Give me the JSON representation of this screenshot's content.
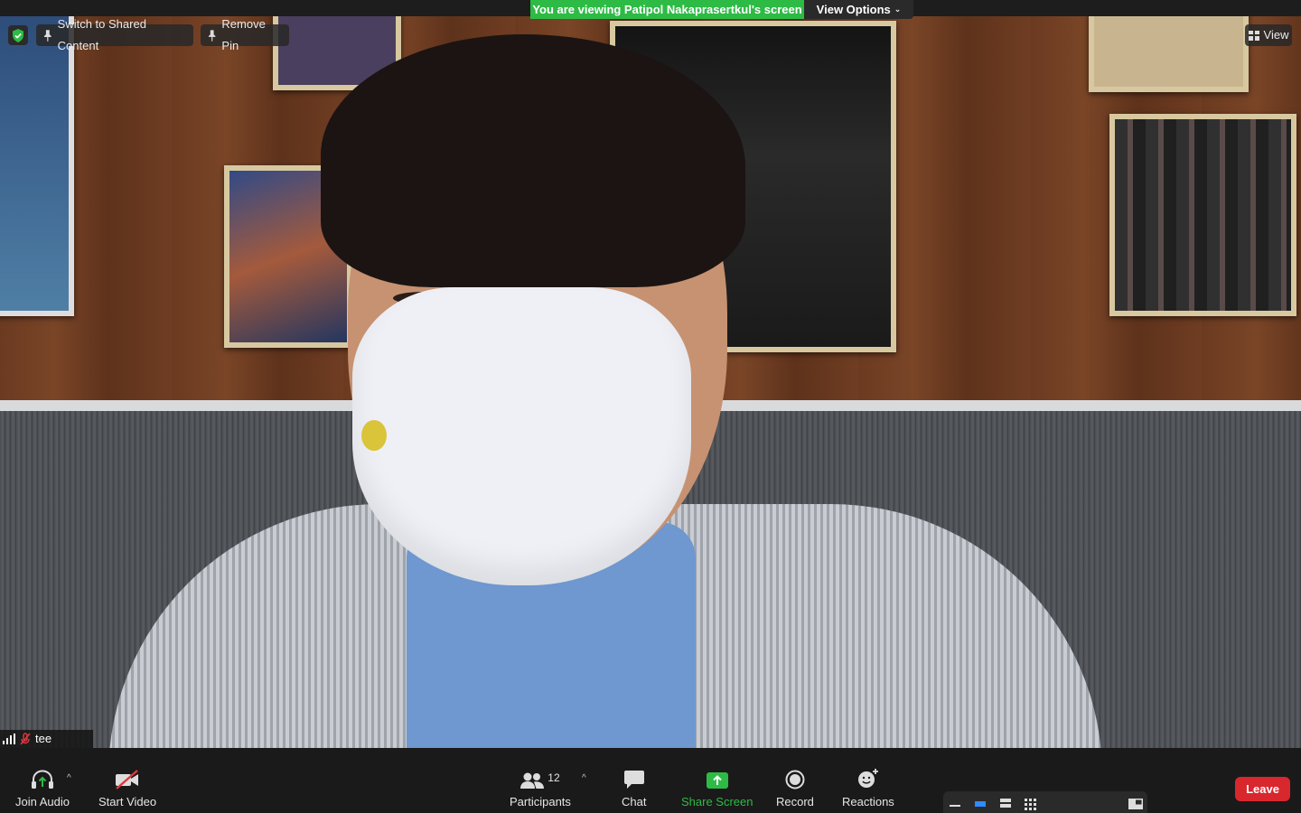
{
  "banner": {
    "viewing_text": "You are viewing Patipol Nakaprasertkul's screen",
    "view_options_label": "View Options"
  },
  "overlay": {
    "switch_label": "Switch to Shared Content",
    "remove_pin_label": "Remove Pin",
    "view_label": "View",
    "participant_name": "tee"
  },
  "toolbar": {
    "join_audio": "Join Audio",
    "start_video": "Start Video",
    "participants": "Participants",
    "participant_count": "12",
    "chat": "Chat",
    "share_screen": "Share Screen",
    "record": "Record",
    "reactions": "Reactions",
    "leave": "Leave"
  },
  "colors": {
    "accent_green": "#2dbb45",
    "leave_red": "#d9272e",
    "toolbar_bg": "#1a1a1a"
  },
  "icons": [
    "shield-check-icon",
    "pin-icon",
    "grid-view-icon",
    "signal-icon",
    "mic-muted-icon",
    "headphones-icon",
    "video-off-icon",
    "participants-icon",
    "chat-icon",
    "share-screen-icon",
    "record-icon",
    "reactions-icon"
  ]
}
